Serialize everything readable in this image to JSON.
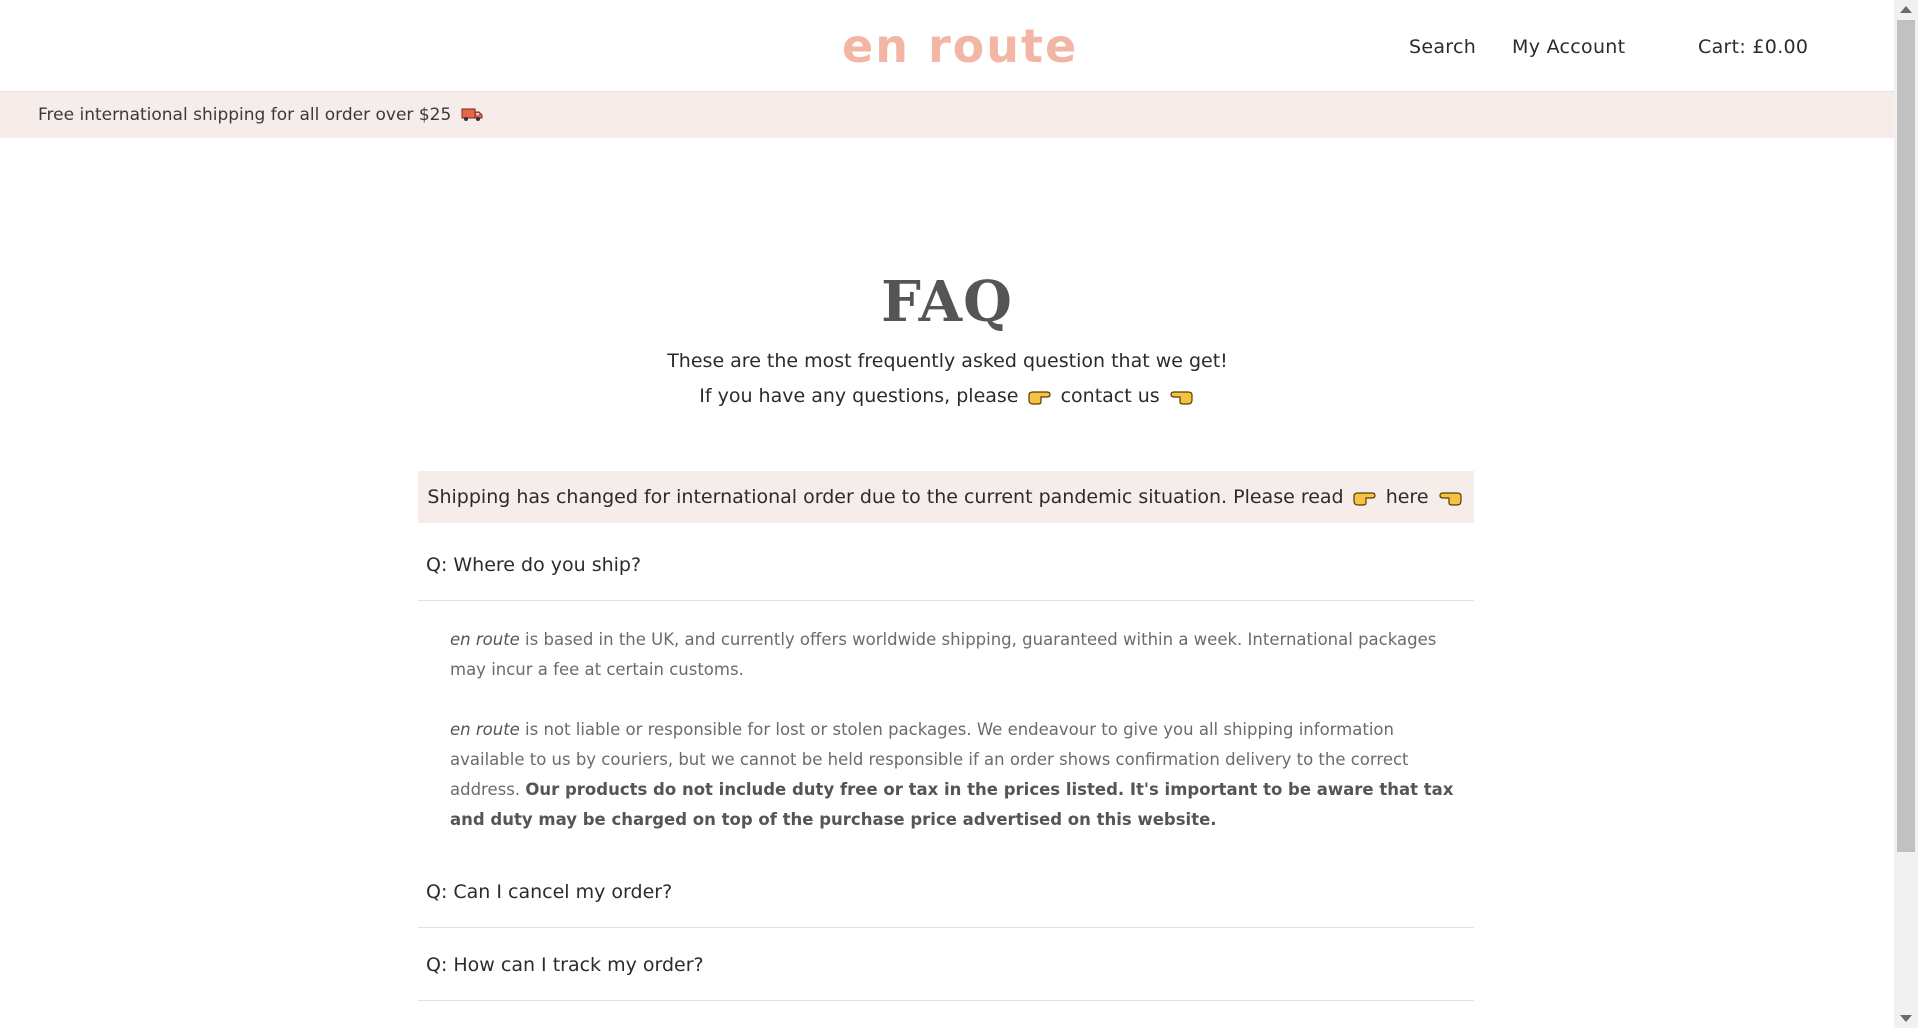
{
  "header": {
    "logo": "en route",
    "nav": {
      "search": "Search",
      "account": "My Account",
      "cart": "Cart: £0.00"
    }
  },
  "announcement": {
    "text": "Free international shipping for all order over $25",
    "icon": "delivery-truck-icon"
  },
  "faq": {
    "title": "FAQ",
    "intro_before": "These are the most frequently asked question that we get! If you have any questions, please",
    "intro_link": "contact us",
    "notice_before": "Shipping has changed for international order due to the current pandemic situation. Please read",
    "notice_link": "here",
    "items": [
      {
        "question": "Q: Where do you ship?",
        "answer": {
          "p1_brand": "en route",
          "p1_text": " is based in the UK, and currently offers worldwide shipping, guaranteed within a week. International packages may incur a fee at certain customs.",
          "p2_brand": "en route",
          "p2_text": " is not liable or responsible for lost or stolen packages. We endeavour to give you all shipping information available to us by couriers, but we cannot be held responsible if an order shows confirmation delivery to the correct address. ",
          "p2_bold": "Our products do not include duty free or tax in the prices listed. It's important to be aware that tax and duty may be charged on top of the purchase price advertised on this website."
        }
      },
      {
        "question": "Q: Can I cancel my order?"
      },
      {
        "question": "Q: How can I track my order?"
      }
    ]
  },
  "colors": {
    "logo": "#f3b5a4",
    "announcement_bg": "#f6ece9",
    "title": "#555555",
    "hand_icon": "#f5c242"
  }
}
